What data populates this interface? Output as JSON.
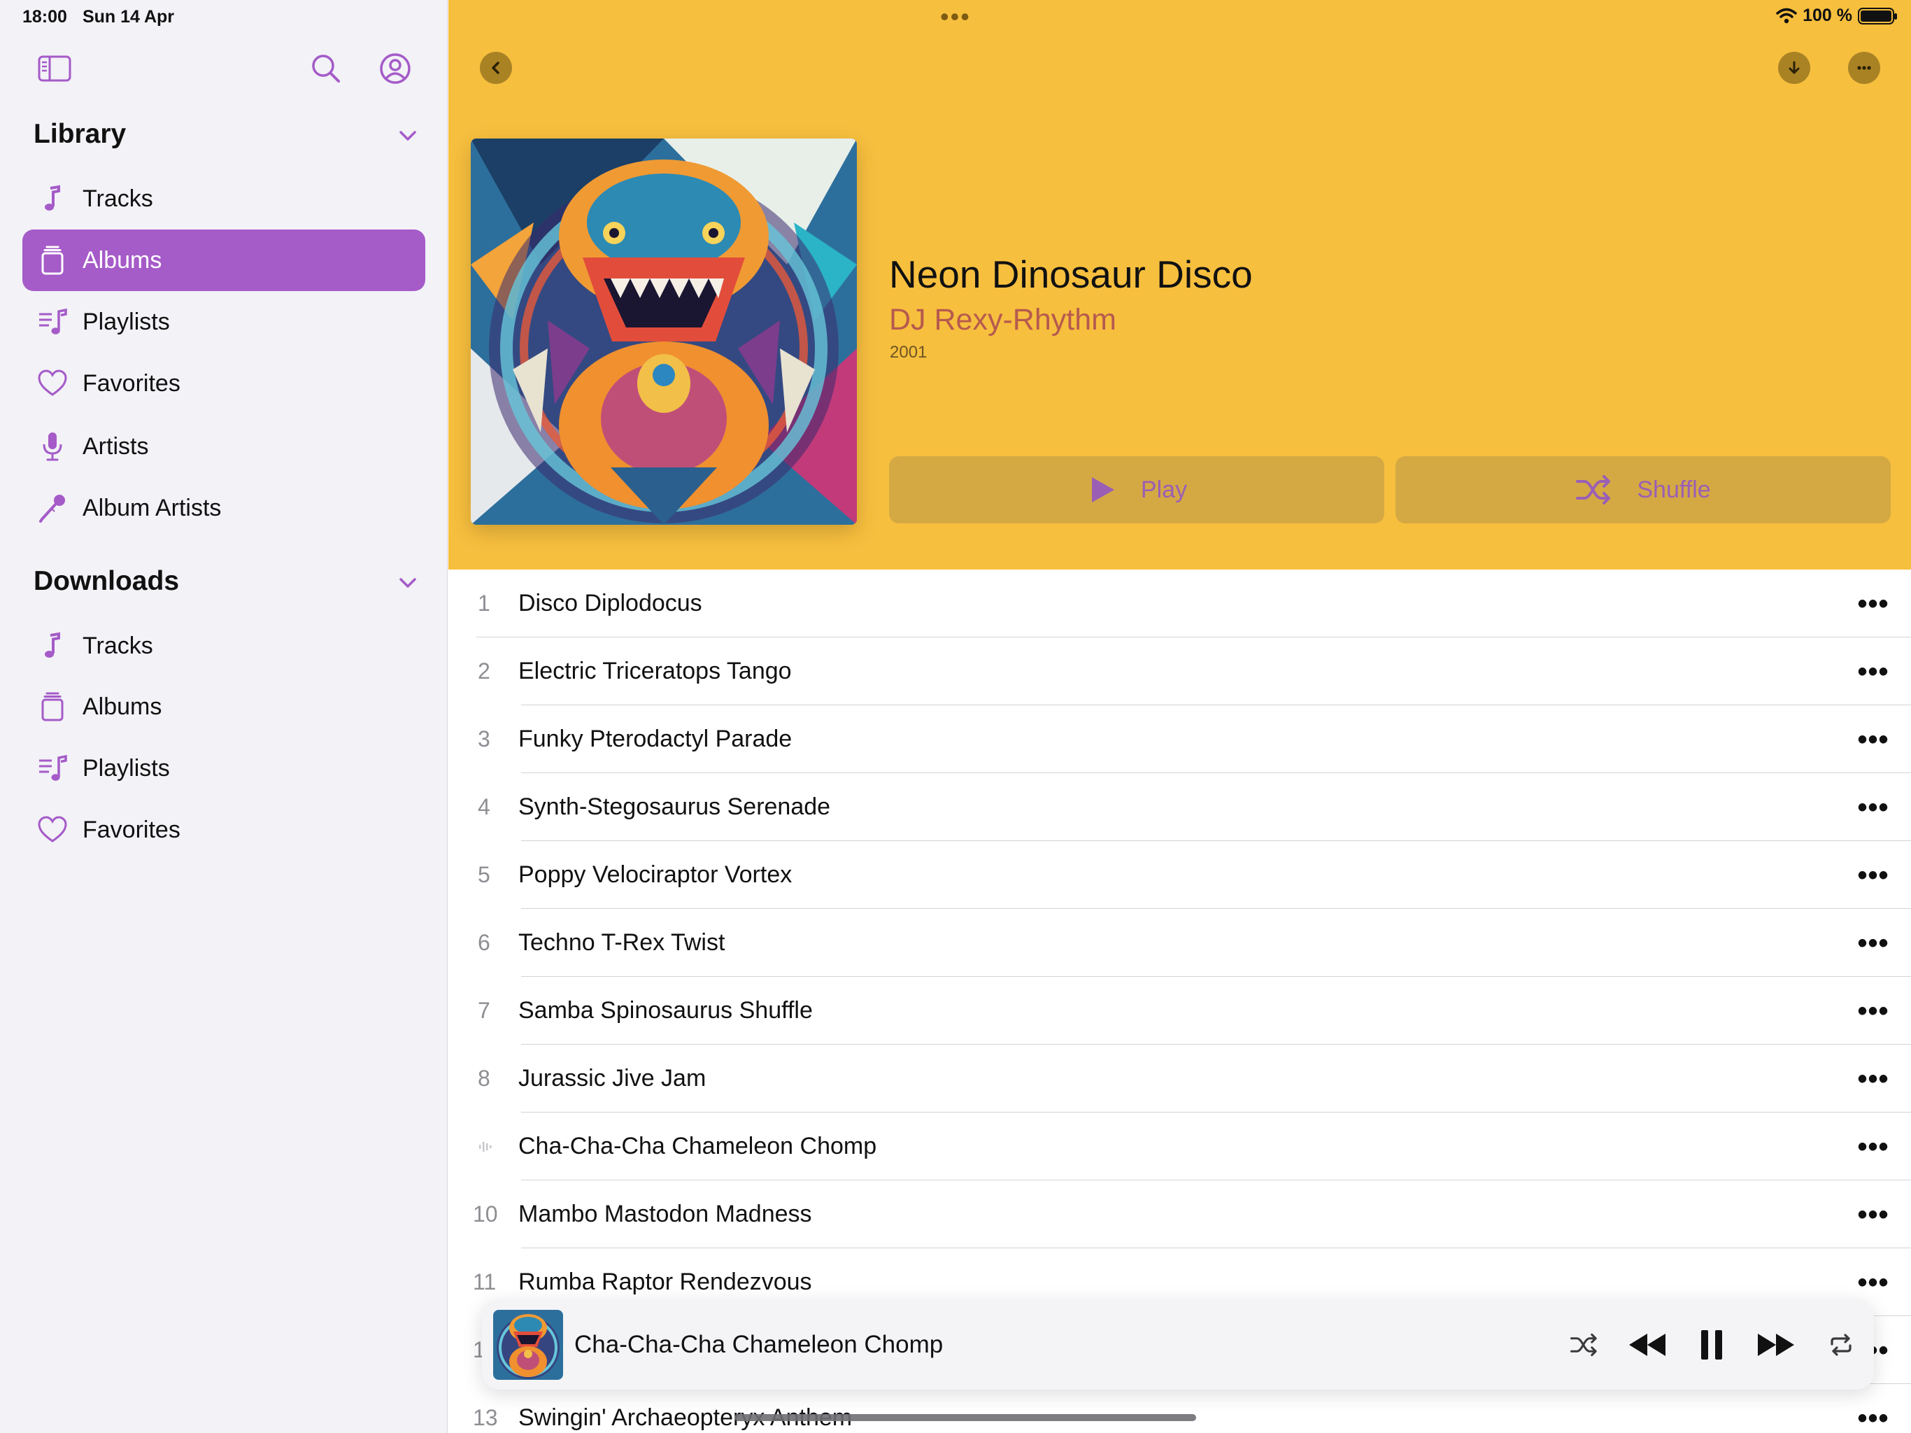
{
  "status": {
    "time": "18:00",
    "date": "Sun 14 Apr",
    "battery": "100 %"
  },
  "colors": {
    "accent": "#a55bc8",
    "header_bg": "#f7bf3e",
    "artist": "#b65a4f"
  },
  "sidebar": {
    "library": {
      "title": "Library",
      "items": [
        {
          "label": "Tracks",
          "icon": "music-note-icon"
        },
        {
          "label": "Albums",
          "icon": "album-stack-icon",
          "active": true
        },
        {
          "label": "Playlists",
          "icon": "playlist-icon"
        },
        {
          "label": "Favorites",
          "icon": "heart-icon"
        },
        {
          "label": "Artists",
          "icon": "microphone-icon"
        },
        {
          "label": "Album Artists",
          "icon": "mic-tilted-icon"
        }
      ]
    },
    "downloads": {
      "title": "Downloads",
      "items": [
        {
          "label": "Tracks",
          "icon": "music-note-icon"
        },
        {
          "label": "Albums",
          "icon": "album-stack-icon"
        },
        {
          "label": "Playlists",
          "icon": "playlist-icon"
        },
        {
          "label": "Favorites",
          "icon": "heart-icon"
        }
      ]
    }
  },
  "album": {
    "title": "Neon Dinosaur Disco",
    "artist": "DJ Rexy-Rhythm",
    "year": "2001",
    "play_label": "Play",
    "shuffle_label": "Shuffle"
  },
  "tracks": [
    {
      "num": "1",
      "title": "Disco Diplodocus"
    },
    {
      "num": "2",
      "title": "Electric Triceratops Tango"
    },
    {
      "num": "3",
      "title": "Funky Pterodactyl Parade"
    },
    {
      "num": "4",
      "title": "Synth-Stegosaurus Serenade"
    },
    {
      "num": "5",
      "title": "Poppy Velociraptor Vortex"
    },
    {
      "num": "6",
      "title": "Techno T-Rex Twist"
    },
    {
      "num": "7",
      "title": "Samba Spinosaurus Shuffle"
    },
    {
      "num": "8",
      "title": "Jurassic Jive Jam"
    },
    {
      "num": "",
      "title": "Cha-Cha-Cha Chameleon Chomp",
      "playing": true
    },
    {
      "num": "10",
      "title": "Mambo Mastodon Madness"
    },
    {
      "num": "11",
      "title": "Rumba Raptor Rendezvous"
    },
    {
      "num": "1",
      "title": ""
    },
    {
      "num": "13",
      "title": "Swingin' Archaeopteryx Anthem"
    }
  ],
  "now_playing": {
    "title": "Cha-Cha-Cha Chameleon Chomp"
  }
}
